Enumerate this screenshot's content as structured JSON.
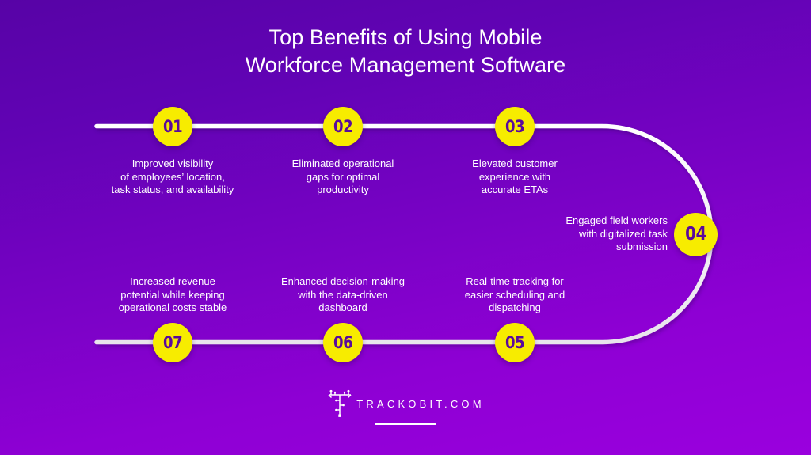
{
  "theme": {
    "bg_top": "#5703a6",
    "bg_bottom": "#9a00de",
    "accent_circle": "#f7ec00",
    "number_color": "#5a0a9c",
    "line_color": "#f2f0f2",
    "text_color": "#ffffff"
  },
  "header": {
    "title_line_1": "Top Benefits of Using Mobile",
    "title_line_2": "Workforce Management Software"
  },
  "steps": [
    {
      "number": "01",
      "caption": "Improved visibility\nof employees’ location,\ntask status, and availability",
      "align": "center",
      "row": "top"
    },
    {
      "number": "02",
      "caption": "Eliminated operational\ngaps for optimal\nproductivity",
      "align": "center",
      "row": "top"
    },
    {
      "number": "03",
      "caption": "Elevated customer\nexperience with\naccurate ETAs",
      "align": "center",
      "row": "top"
    },
    {
      "number": "04",
      "caption": "Engaged field workers\nwith digitalized task\nsubmission",
      "align": "right",
      "row": "middle"
    },
    {
      "number": "05",
      "caption": "Real-time tracking for\neasier scheduling and\ndispatching",
      "align": "center",
      "row": "bottom"
    },
    {
      "number": "06",
      "caption": "Enhanced decision-making\nwith the data-driven\ndashboard",
      "align": "center",
      "row": "bottom"
    },
    {
      "number": "07",
      "caption": "Increased revenue\npotential while keeping\noperational costs stable",
      "align": "center",
      "row": "bottom"
    }
  ],
  "footer": {
    "brand_text": "TRACKOBIT.COM",
    "logo_icon": "trackobit-t-monogram-icon"
  }
}
